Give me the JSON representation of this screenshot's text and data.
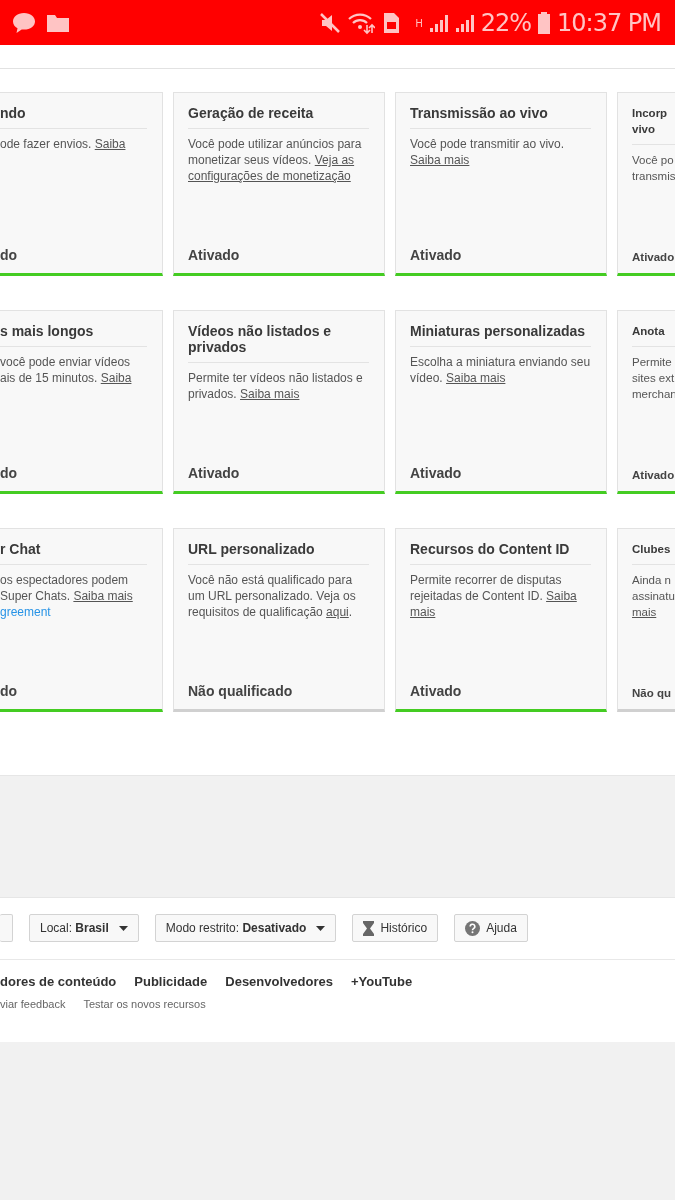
{
  "status_bar": {
    "h_label": "H",
    "battery_text": "22%",
    "time": "10:37 PM"
  },
  "cards": [
    {
      "enabled": true,
      "title": [
        "ndo"
      ],
      "description": [
        [
          {
            "text": "ode fazer envios. ",
            "kind": "text"
          },
          {
            "text": "Saiba",
            "kind": "link"
          }
        ]
      ],
      "status": "do"
    },
    {
      "enabled": true,
      "title": [
        "Geração de receita"
      ],
      "description": [
        [
          {
            "text": "Você pode utilizar anúncios para",
            "kind": "text"
          }
        ],
        [
          {
            "text": "monetizar seus vídeos. ",
            "kind": "text"
          },
          {
            "text": "Veja as",
            "kind": "link"
          }
        ],
        [
          {
            "text": "configurações de monetização",
            "kind": "link"
          }
        ]
      ],
      "status": "Ativado"
    },
    {
      "enabled": true,
      "title": [
        "Transmissão ao vivo"
      ],
      "description": [
        [
          {
            "text": "Você pode transmitir ao vivo.",
            "kind": "text"
          }
        ],
        [
          {
            "text": "Saiba mais",
            "kind": "link"
          }
        ]
      ],
      "status": "Ativado"
    },
    {
      "enabled": true,
      "title": [
        "Incorp",
        "vivo"
      ],
      "description": [
        [
          {
            "text": "Você po",
            "kind": "text"
          }
        ],
        [
          {
            "text": "transmis",
            "kind": "text"
          }
        ]
      ],
      "status": "Ativado"
    },
    {
      "enabled": true,
      "title": [
        "s mais longos"
      ],
      "description": [
        [
          {
            "text": "você pode enviar vídeos",
            "kind": "text"
          }
        ],
        [
          {
            "text": "ais de 15 minutos. ",
            "kind": "text"
          },
          {
            "text": "Saiba",
            "kind": "link"
          }
        ]
      ],
      "status": "do"
    },
    {
      "enabled": true,
      "title": [
        "Vídeos não listados e",
        "privados"
      ],
      "description": [
        [
          {
            "text": "Permite ter vídeos não listados e",
            "kind": "text"
          }
        ],
        [
          {
            "text": "privados. ",
            "kind": "text"
          },
          {
            "text": "Saiba mais",
            "kind": "link"
          }
        ]
      ],
      "status": "Ativado"
    },
    {
      "enabled": true,
      "title": [
        "Miniaturas personalizadas"
      ],
      "description": [
        [
          {
            "text": "Escolha a miniatura enviando seu",
            "kind": "text"
          }
        ],
        [
          {
            "text": "vídeo. ",
            "kind": "text"
          },
          {
            "text": "Saiba mais",
            "kind": "link"
          }
        ]
      ],
      "status": "Ativado"
    },
    {
      "enabled": true,
      "title": [
        "Anota"
      ],
      "description": [
        [
          {
            "text": "Permite",
            "kind": "text"
          }
        ],
        [
          {
            "text": "sites ext",
            "kind": "text"
          }
        ],
        [
          {
            "text": "merchan",
            "kind": "text"
          }
        ]
      ],
      "status": "Ativado"
    },
    {
      "enabled": true,
      "title": [
        "r Chat"
      ],
      "description": [
        [
          {
            "text": "os espectadores podem",
            "kind": "text"
          }
        ],
        [
          {
            "text": "Super Chats. ",
            "kind": "text"
          },
          {
            "text": "Saiba mais",
            "kind": "link"
          }
        ],
        [
          {
            "text": "greement",
            "kind": "external"
          }
        ]
      ],
      "status": "do"
    },
    {
      "enabled": false,
      "title": [
        "URL personalizado"
      ],
      "description": [
        [
          {
            "text": "Você não está qualificado para",
            "kind": "text"
          }
        ],
        [
          {
            "text": "um URL personalizado. Veja os",
            "kind": "text"
          }
        ],
        [
          {
            "text": "requisitos de qualificação ",
            "kind": "text"
          },
          {
            "text": "aqui",
            "kind": "link"
          },
          {
            "text": ".",
            "kind": "text"
          }
        ]
      ],
      "status": "Não qualificado"
    },
    {
      "enabled": true,
      "title": [
        "Recursos do Content ID"
      ],
      "description": [
        [
          {
            "text": "Permite recorrer de disputas",
            "kind": "text"
          }
        ],
        [
          {
            "text": "rejeitadas de Content ID. ",
            "kind": "text"
          },
          {
            "text": "Saiba",
            "kind": "link"
          }
        ],
        [
          {
            "text": "mais",
            "kind": "link"
          }
        ]
      ],
      "status": "Ativado"
    },
    {
      "enabled": false,
      "title": [
        "Clubes"
      ],
      "description": [
        [
          {
            "text": "Ainda n",
            "kind": "text"
          }
        ],
        [
          {
            "text": "assinatu",
            "kind": "text"
          }
        ],
        [
          {
            "text": "mais",
            "kind": "link"
          }
        ]
      ],
      "status": "Não qu"
    }
  ],
  "footer_buttons": [
    {
      "kind": "partial"
    },
    {
      "kind": "dropdown",
      "label": "Local: ",
      "value": "Brasil"
    },
    {
      "kind": "dropdown",
      "label": "Modo restrito: ",
      "value": "Desativado"
    },
    {
      "kind": "history",
      "label": "Histórico"
    },
    {
      "kind": "help",
      "label": "Ajuda"
    }
  ],
  "footer_links": [
    "dores de conteúdo",
    "Publicidade",
    "Desenvolvedores",
    "+YouTube"
  ],
  "footer_small_links": [
    "viar feedback",
    "Testar os novos recursos"
  ]
}
